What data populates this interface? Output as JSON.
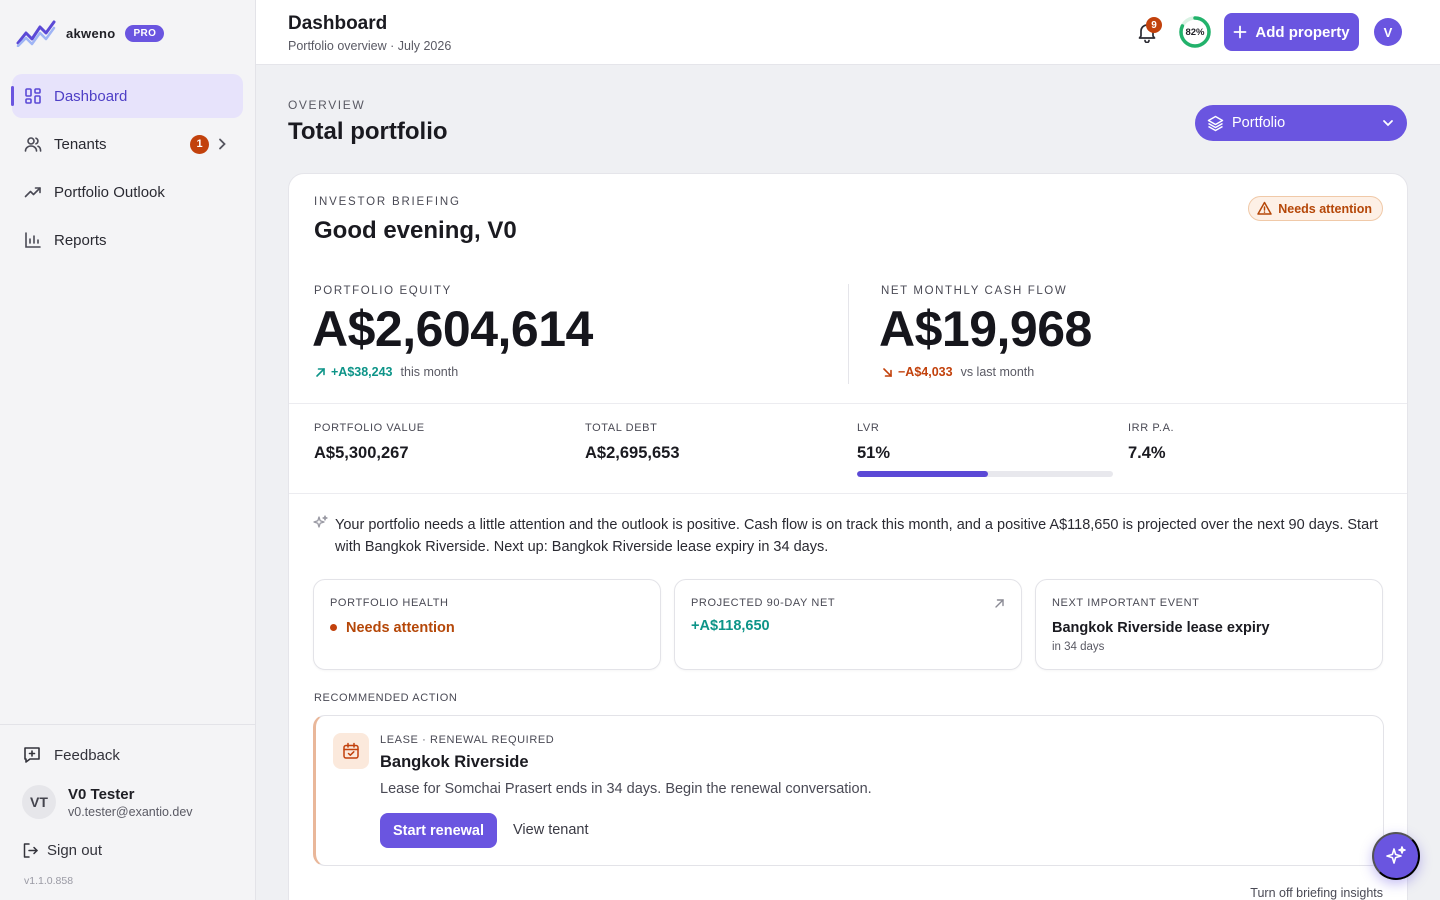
{
  "brand": {
    "name": "akweno",
    "badge": "PRO"
  },
  "sidebar": {
    "items": [
      {
        "label": "Dashboard",
        "icon": "dashboard-icon",
        "active": true
      },
      {
        "label": "Tenants",
        "icon": "users-icon",
        "badge": "1"
      },
      {
        "label": "Portfolio Outlook",
        "icon": "trending-up-icon"
      },
      {
        "label": "Reports",
        "icon": "bar-chart-icon"
      }
    ],
    "feedback": "Feedback",
    "user": {
      "initials": "VT",
      "name": "V0 Tester",
      "email": "v0.tester@exantio.dev"
    },
    "signout": "Sign out",
    "version": "v1.1.0.858"
  },
  "header": {
    "title": "Dashboard",
    "subtitle": "Portfolio overview · July 2026",
    "notifications": "9",
    "progress_label": "82%",
    "progress_value": 0.82,
    "add_label": "Add property",
    "avatar": "V"
  },
  "page": {
    "kicker": "OVERVIEW",
    "title": "Total portfolio",
    "selector": "Portfolio"
  },
  "briefing": {
    "kicker": "INVESTOR BRIEFING",
    "greeting": "Good evening, V0",
    "status_pill": "Needs attention",
    "equity": {
      "label": "PORTFOLIO EQUITY",
      "value": "A$2,604,614",
      "delta": "+A$38,243",
      "delta_note": "this month"
    },
    "cashflow": {
      "label": "NET MONTHLY CASH FLOW",
      "value": "A$19,968",
      "delta": "−A$4,033",
      "delta_note": "vs last month"
    },
    "stats": [
      {
        "label": "PORTFOLIO VALUE",
        "value": "A$5,300,267"
      },
      {
        "label": "TOTAL DEBT",
        "value": "A$2,695,653"
      },
      {
        "label": "LVR",
        "value": "51%"
      },
      {
        "label": "IRR P.A.",
        "value": "7.4%"
      }
    ],
    "lvr_fraction": 0.51,
    "summary": "Your portfolio needs a little attention and the outlook is positive. Cash flow is on track this month, and a positive A$118,650 is projected over the next 90 days. Start with Bangkok Riverside. Next up: Bangkok Riverside lease expiry in 34 days.",
    "health": {
      "label": "PORTFOLIO HEALTH",
      "value": "Needs attention"
    },
    "projected": {
      "label": "PROJECTED 90-DAY NET",
      "value": "+A$118,650"
    },
    "next_event": {
      "label": "NEXT IMPORTANT EVENT",
      "value": "Bangkok Riverside lease expiry",
      "sub": "in 34 days"
    },
    "recommended_label": "RECOMMENDED ACTION",
    "action": {
      "kicker": "LEASE · RENEWAL REQUIRED",
      "title": "Bangkok Riverside",
      "description": "Lease for Somchai Prasert ends in 34 days. Begin the renewal conversation.",
      "primary": "Start renewal",
      "secondary": "View tenant"
    },
    "turn_off": "Turn off briefing insights"
  },
  "colors": {
    "accent": "#6a55e0",
    "positive": "#0d9488",
    "warning": "#c2410c"
  }
}
